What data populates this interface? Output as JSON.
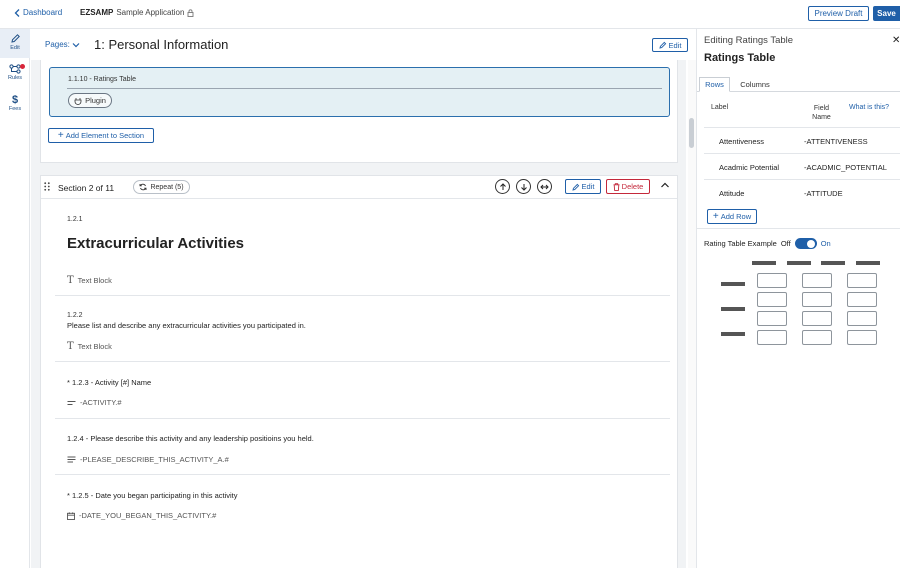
{
  "topbar": {
    "back_label": "Dashboard",
    "app_code": "EZSAMP",
    "app_name": "Sample Application",
    "preview_label": "Preview Draft",
    "save_label": "Save"
  },
  "rail": {
    "edit_label": "Edit",
    "rules_label": "Rules",
    "fees_label": "Fees"
  },
  "page": {
    "pages_label": "Pages:",
    "title": "1: Personal Information",
    "edit_label": "Edit"
  },
  "section1": {
    "ratings_label": "1.1.10 - Ratings Table",
    "plugin_label": "Plugin",
    "add_element_label": "Add Element to Section"
  },
  "section2": {
    "label": "Section 2 of 11",
    "repeat_label": "Repeat (5)",
    "edit_label": "Edit",
    "delete_label": "Delete",
    "items": [
      {
        "num": "1.2.1",
        "title": "Extracurricular Activities",
        "meta": "Text Block"
      },
      {
        "num": "1.2.2",
        "text": "Please list and describe any extracurricular activities you participated in.",
        "meta": "Text Block"
      },
      {
        "text": "* 1.2.3 - Activity [#] Name",
        "meta": "-ACTIVITY.#"
      },
      {
        "text": "1.2.4 - Please describe this activity and any leadership positioins you held.",
        "meta": "-PLEASE_DESCRIBE_THIS_ACTIVITY_A.#"
      },
      {
        "text": "* 1.2.5 - Date you began participating in this activity",
        "meta": "-DATE_YOU_BEGAN_THIS_ACTIVITY.#"
      }
    ]
  },
  "panel": {
    "top_label": "Editing Ratings Table",
    "title": "Ratings Table",
    "tabs": [
      "Rows",
      "Columns"
    ],
    "col_label": "Label",
    "col_field": "Field Name",
    "what_is_this": "What is this?",
    "rows": [
      {
        "label": "Attentiveness",
        "field": "-ATTENTIVENESS"
      },
      {
        "label": "Acadmic Potential",
        "field": "-ACADMIC_POTENTIAL"
      },
      {
        "label": "Attitude",
        "field": "-ATTITUDE"
      }
    ],
    "add_row_label": "Add Row",
    "example_label": "Rating Table Example",
    "toggle_off": "Off",
    "toggle_on": "On",
    "toggle_state": "on"
  },
  "colors": {
    "accent": "#1f5fa8",
    "danger": "#c4283b",
    "selected_bg": "#e4f0f4"
  }
}
